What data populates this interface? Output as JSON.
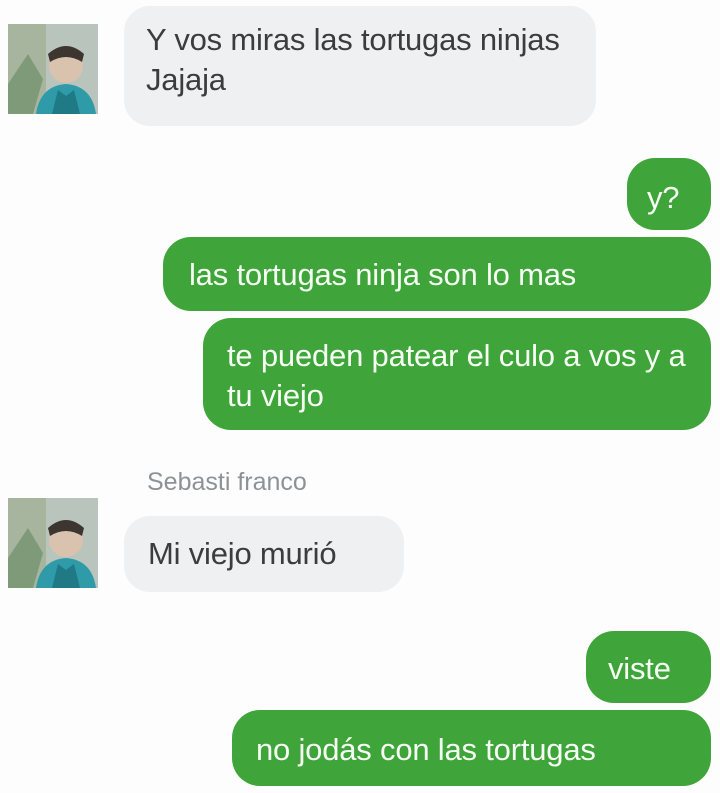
{
  "messages": [
    {
      "direction": "incoming",
      "text": "Y vos miras las tortugas ninjas Jajaja"
    },
    {
      "direction": "outgoing",
      "text": "y?"
    },
    {
      "direction": "outgoing",
      "text": "las tortugas ninja son lo mas"
    },
    {
      "direction": "outgoing",
      "text": "te pueden patear el culo a vos y a tu viejo"
    },
    {
      "direction": "incoming",
      "sender": "Sebasti franco",
      "text": "Mi viejo murió"
    },
    {
      "direction": "outgoing",
      "text": "viste"
    },
    {
      "direction": "outgoing",
      "text": "no jodás con las tortugas"
    }
  ],
  "colors": {
    "outgoing_bubble": "#3fa43a",
    "incoming_bubble": "#eef0f2",
    "sender_name": "#8d9296"
  },
  "icons": [
    "avatar-photo"
  ]
}
